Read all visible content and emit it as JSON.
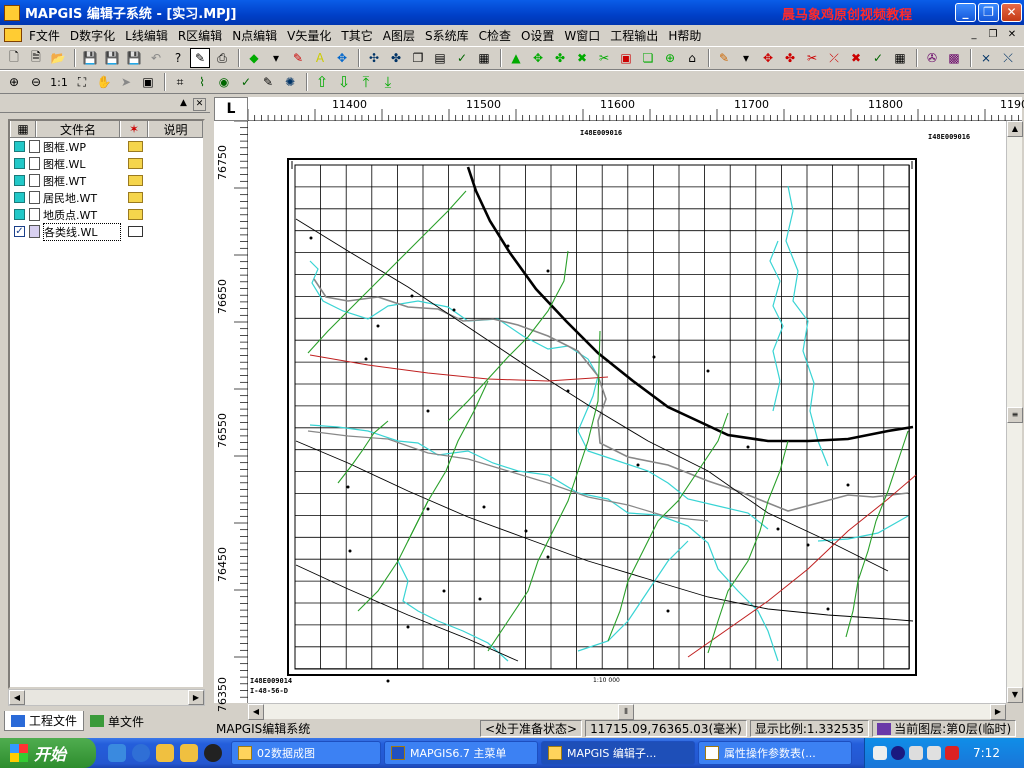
{
  "window": {
    "title": "MAPGIS 编辑子系统 - [实习.MPJ]",
    "watermark": "晨马象鸡原创视频教程"
  },
  "menu": [
    "F文件",
    "D数字化",
    "L线编辑",
    "R区编辑",
    "N点编辑",
    "V矢量化",
    "T其它",
    "A图层",
    "S系统库",
    "C检查",
    "O设置",
    "W窗口",
    "工程输出",
    "H帮助"
  ],
  "panel": {
    "columns": [
      "文件名",
      "说明"
    ],
    "files": [
      {
        "name": "图框.WP",
        "checked": false
      },
      {
        "name": "图框.WL",
        "checked": false
      },
      {
        "name": "图框.WT",
        "checked": false
      },
      {
        "name": "居民地.WT",
        "checked": false
      },
      {
        "name": "地质点.WT",
        "checked": false
      },
      {
        "name": "各类线.WL",
        "checked": true
      }
    ],
    "tabs": [
      "工程文件",
      "单文件"
    ]
  },
  "ruler": {
    "corner": "L",
    "x_labels": [
      "11400",
      "11500",
      "11600",
      "11700",
      "11800",
      "1190"
    ],
    "y_labels": [
      "76750",
      "76650",
      "76550",
      "76450",
      "76350"
    ]
  },
  "map": {
    "frame_label_top_left": "I48E009016",
    "frame_label_top_right": "I48E009016",
    "frame_label_bottom_left": "I48E009014",
    "frame_label_bottom_left2": "I-48-56-D",
    "scale_text": "1:10 000"
  },
  "status": {
    "system": "MAPGIS编辑系统",
    "state": "<处于准备状态>",
    "coords": "11715.09,76365.03(毫米)",
    "scale": "显示比例:1.332535",
    "layer": "当前图层:第0层(临时)"
  },
  "taskbar": {
    "start": "开始",
    "items": [
      "02数据成图",
      "MAPGIS6.7 主菜单",
      "MAPGIS 编辑子...",
      "属性操作参数表(..."
    ],
    "active_index": 2,
    "clock": "7:12"
  }
}
